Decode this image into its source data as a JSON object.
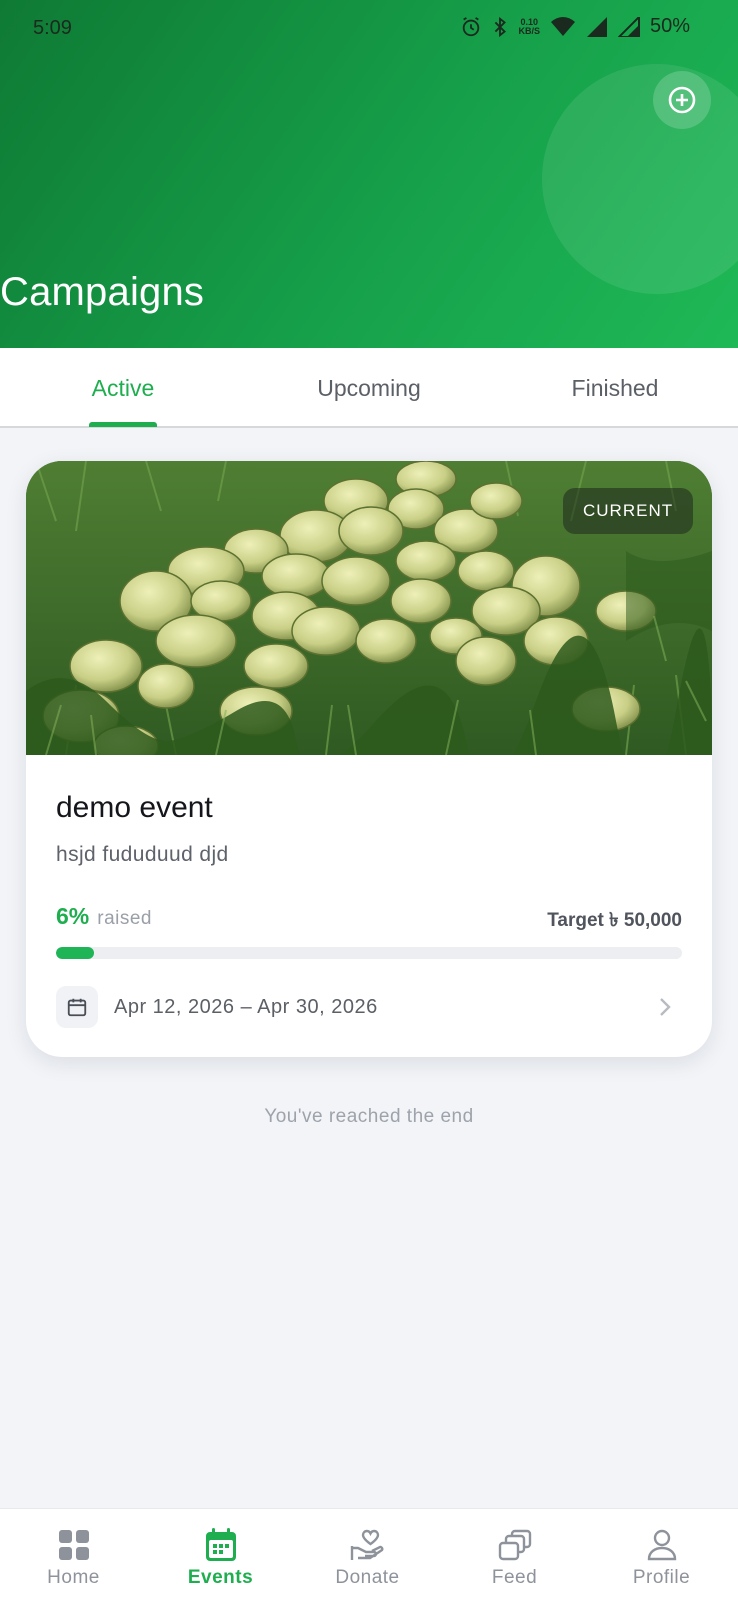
{
  "status_bar": {
    "time": "5:09",
    "net_speed_value": "0.10",
    "net_speed_unit": "KB/S",
    "battery": "50%"
  },
  "header": {
    "title": "Campaigns",
    "add_icon": "plus-circle-icon"
  },
  "tabs": [
    {
      "label": "Active",
      "active": true
    },
    {
      "label": "Upcoming",
      "active": false
    },
    {
      "label": "Finished",
      "active": false
    }
  ],
  "campaign": {
    "badge": "CURRENT",
    "title": "demo event",
    "description": "hsjd fududuud djd",
    "raised_percent": "6%",
    "raised_label": "raised",
    "progress_fraction": 0.06,
    "target": "Target ৳ 50,000",
    "date_range": "Apr 12, 2026 – Apr 30, 2026",
    "image_icon": "watermelon-field-photo"
  },
  "end_message": "You've reached the end",
  "bottom_nav": [
    {
      "label": "Home",
      "icon": "grid-icon",
      "active": false
    },
    {
      "label": "Events",
      "icon": "calendar-icon",
      "active": true
    },
    {
      "label": "Donate",
      "icon": "hand-heart-icon",
      "active": false
    },
    {
      "label": "Feed",
      "icon": "feed-cards-icon",
      "active": false
    },
    {
      "label": "Profile",
      "icon": "user-icon",
      "active": false
    }
  ],
  "colors": {
    "accent": "#1fae4f",
    "header_start": "#0f7a34",
    "header_end": "#1fb957",
    "background": "#f2f4f8"
  }
}
